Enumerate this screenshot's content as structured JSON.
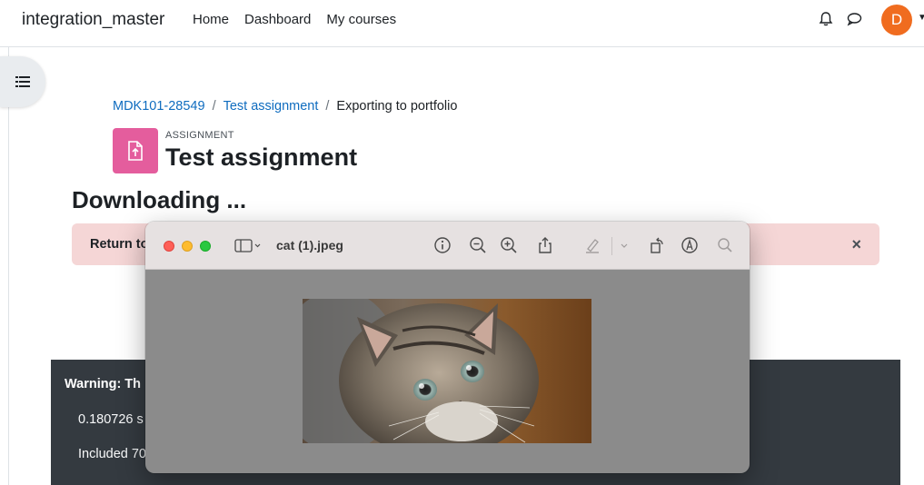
{
  "navbar": {
    "site_name": "integration_master",
    "links": [
      "Home",
      "Dashboard",
      "My courses"
    ],
    "user_initial": "D"
  },
  "breadcrumb": {
    "course": "MDK101-28549",
    "assignment": "Test assignment",
    "current": "Exporting to portfolio",
    "separator": "/"
  },
  "header": {
    "module_type": "ASSIGNMENT",
    "title": "Test assignment"
  },
  "page": {
    "heading": "Downloading ..."
  },
  "alert": {
    "text": "Return to",
    "close": "×",
    "color": "#f5d6d6"
  },
  "footer": {
    "warning": "Warning: Th",
    "line1": "0.180726 s",
    "line2": "Included 70"
  },
  "preview_window": {
    "title": "cat (1).jpeg",
    "image": "kitten photo",
    "toolbar_icons": [
      "sidebar-icon",
      "info-icon",
      "zoom-out-icon",
      "zoom-in-icon",
      "share-icon",
      "highlight-icon",
      "rotate-icon",
      "markup-icon",
      "search-icon"
    ]
  },
  "colors": {
    "accent": "#0f6cbf",
    "module_icon": "#e45d9d",
    "avatar": "#f06c1f",
    "footer": "#343a40"
  }
}
